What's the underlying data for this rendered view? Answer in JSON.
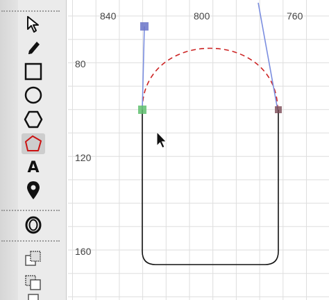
{
  "toolbar": {
    "tools": [
      {
        "id": "select",
        "icon": "arrow-pointer-icon"
      },
      {
        "id": "pencil",
        "icon": "pencil-icon"
      },
      {
        "id": "rectangle",
        "icon": "square-outline-icon"
      },
      {
        "id": "ellipse",
        "icon": "circle-outline-icon"
      },
      {
        "id": "polygon",
        "icon": "hexagon-outline-icon"
      },
      {
        "id": "path",
        "icon": "pentagon-path-icon",
        "selected": true
      },
      {
        "id": "text",
        "icon": "text-a-icon",
        "label": "A"
      },
      {
        "id": "marker",
        "icon": "map-pin-icon"
      },
      {
        "id": "zoom",
        "icon": "zoom-ring-icon"
      },
      {
        "id": "group-stack-1",
        "icon": "stack-layers-icon"
      },
      {
        "id": "group-stack-2",
        "icon": "stack-layers-alt-icon"
      }
    ]
  },
  "ruler": {
    "top_labels": [
      "840",
      "800",
      "760"
    ],
    "left_labels": [
      "80",
      "120",
      "160"
    ]
  },
  "colors": {
    "accent_path": "#cc2222",
    "handle_line": "#7b8ee0",
    "handle_start": "#6a74c8",
    "anchor_green": "#5fbf6f",
    "anchor_dark": "#7a4a55",
    "grid": "#dedede"
  }
}
